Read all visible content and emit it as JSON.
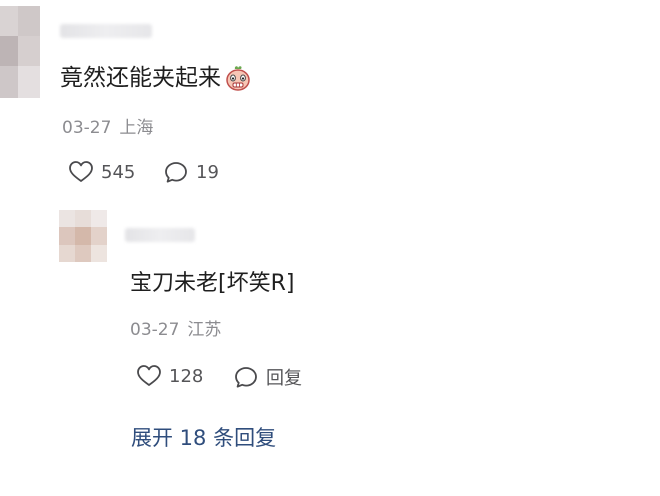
{
  "comment": {
    "text": "竟然还能夹起来",
    "emoji": "grimacing-face-emoji",
    "date": "03-27",
    "location": "上海",
    "likes": "545",
    "comments": "19"
  },
  "reply": {
    "text": "宝刀未老[坏笑R]",
    "date": "03-27",
    "location": "江苏",
    "likes": "128",
    "reply_label": "回复"
  },
  "expand_replies": "展开 18 条回复",
  "colors": {
    "text": "#1f1f1f",
    "meta": "#8c8c90",
    "action": "#555558",
    "link": "#2f4d7c"
  }
}
